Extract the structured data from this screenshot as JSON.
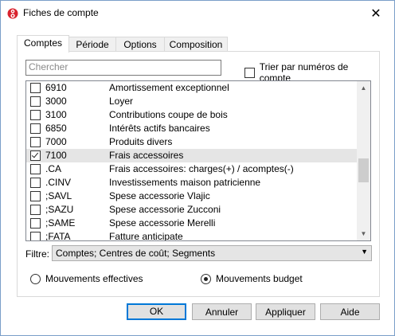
{
  "window": {
    "title": "Fiches de compte",
    "close_label": "✕"
  },
  "tabs": [
    {
      "label": "Comptes"
    },
    {
      "label": "Période"
    },
    {
      "label": "Options"
    },
    {
      "label": "Composition"
    }
  ],
  "search": {
    "placeholder": "Chercher",
    "value": ""
  },
  "sort": {
    "label": "Trier par numéros de compte",
    "checked": false
  },
  "accounts": [
    {
      "code": "6910",
      "desc": "Amortissement exceptionnel",
      "checked": false
    },
    {
      "code": "3000",
      "desc": "Loyer",
      "checked": false
    },
    {
      "code": "3100",
      "desc": "Contributions coupe de bois",
      "checked": false
    },
    {
      "code": "6850",
      "desc": "Intérêts actifs bancaires",
      "checked": false
    },
    {
      "code": "7000",
      "desc": "Produits divers",
      "checked": false
    },
    {
      "code": "7100",
      "desc": "Frais accessoires",
      "checked": true
    },
    {
      "code": ".CA",
      "desc": "Frais accessoires: charges(+) / acomptes(-)",
      "checked": false
    },
    {
      "code": ".CINV",
      "desc": "Investissements maison patricienne",
      "checked": false
    },
    {
      "code": ";SAVL",
      "desc": "Spese accessorie Vlajic",
      "checked": false
    },
    {
      "code": ";SAZU",
      "desc": "Spese accessorie Zucconi",
      "checked": false
    },
    {
      "code": ";SAME",
      "desc": "Spese accessorie Merelli",
      "checked": false
    },
    {
      "code": ";FATA",
      "desc": "Fatture anticipate",
      "checked": false
    }
  ],
  "filter": {
    "label": "Filtre:",
    "value": "Comptes; Centres de coût; Segments"
  },
  "radios": {
    "effectives": {
      "label": "Mouvements effectives",
      "checked": false
    },
    "budget": {
      "label": "Mouvements budget",
      "checked": true
    }
  },
  "buttons": {
    "ok": "OK",
    "cancel": "Annuler",
    "apply": "Appliquer",
    "help": "Aide"
  }
}
